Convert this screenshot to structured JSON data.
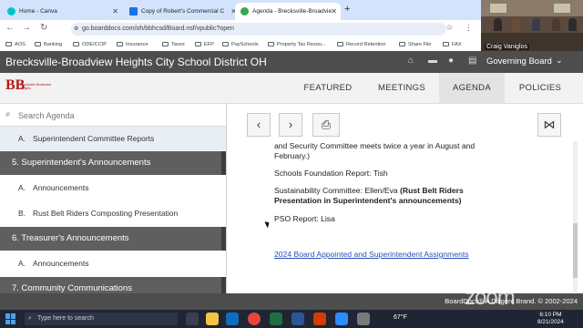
{
  "browser": {
    "tabs": [
      {
        "label": "Home - Canva",
        "active": false,
        "color": "#00c4cc"
      },
      {
        "label": "Copy of Robert's Commercial C",
        "active": false,
        "color": "#1a73e8"
      },
      {
        "label": "Agenda - Brecksville-Broadvie",
        "active": true,
        "color": "#34a853"
      }
    ],
    "url": "go.boarddocs.com/oh/bbhcsd/Board.nsf/vpublic?open",
    "bookmarks": [
      "AOS",
      "Banking",
      "ODE/CCIP",
      "Insurance",
      "Taxes",
      "EFP",
      "PaySchools",
      "Property Tax Resou...",
      "Record Retention",
      "Share File",
      "FAX"
    ]
  },
  "video": {
    "participant": "Craig Vaniglos"
  },
  "site": {
    "title": "Brecksville-Broadview Heights City School District OH",
    "governing_board": "Governing Board",
    "logo_text": "Brecksville Broadview Heights"
  },
  "nav": {
    "tabs": [
      "FEATURED",
      "MEETINGS",
      "AGENDA",
      "POLICIES"
    ],
    "active": "AGENDA"
  },
  "sidebar": {
    "search_placeholder": "Search Agenda",
    "items": [
      {
        "kind": "sub",
        "letter": "A.",
        "label": "Superintendent Committee Reports",
        "selected": true
      },
      {
        "kind": "sec",
        "label": "5. Superintendent's Announcements"
      },
      {
        "kind": "sub",
        "letter": "A.",
        "label": "Announcements"
      },
      {
        "kind": "sub",
        "letter": "B.",
        "label": "Rust Belt Riders Composting Presentation"
      },
      {
        "kind": "sec",
        "label": "6. Treasurer's Announcements"
      },
      {
        "kind": "sub",
        "letter": "A.",
        "label": "Announcements"
      },
      {
        "kind": "sec",
        "label": "7. Community Communications"
      }
    ]
  },
  "content": {
    "line1": "and Security Committee meets twice a year in August and",
    "line2": "February.)",
    "foundation": "Schools Foundation Report: Tish",
    "sustain_prefix": "Sustainability Committee: Ellen/Eva ",
    "sustain_bold1": "(Rust Belt Riders",
    "sustain_bold2": "Presentation in Superintendent's announcements)",
    "pso": "PSO Report: Lisa",
    "link": "2024 Board Appointed and Superintendent Assignments"
  },
  "footer": {
    "copyright": "BoardDocs® A Diligent Brand. © 2002-2024"
  },
  "watermark": "zoom",
  "taskbar": {
    "search_placeholder": "Type here to search",
    "weather": "67°F",
    "time": "6:10 PM",
    "date": "8/21/2024"
  }
}
